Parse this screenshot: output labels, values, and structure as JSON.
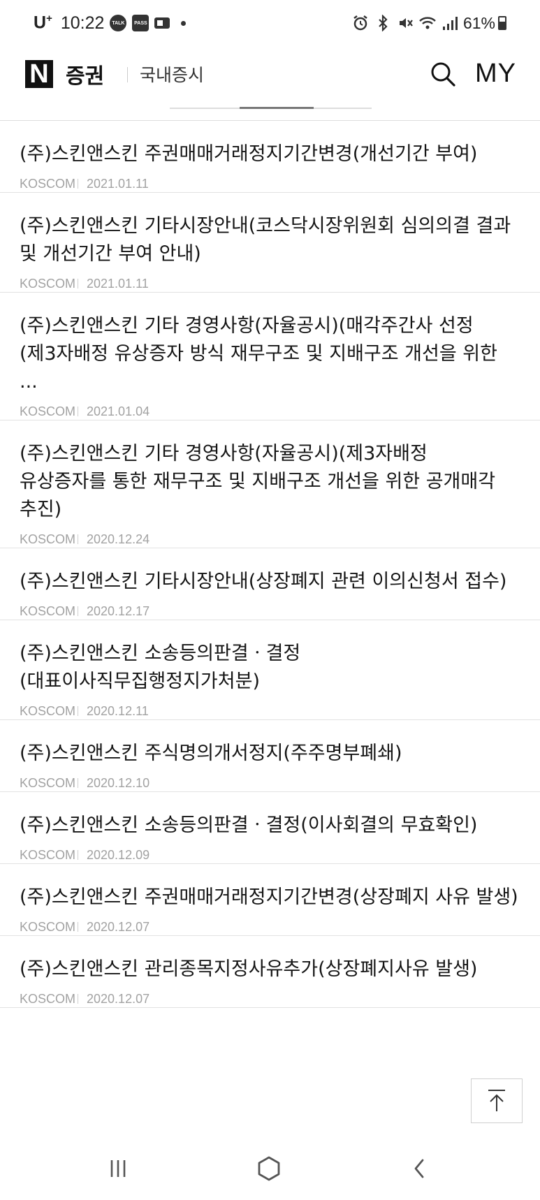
{
  "status_bar": {
    "carrier": "U",
    "carrier_sup": "+",
    "time": "10:22",
    "notif_apps": [
      "TALK",
      "PASS"
    ],
    "battery": "61%",
    "battery_level": 0.61
  },
  "header": {
    "logo_letter": "N",
    "logo_text": "증권",
    "section": "국내증시",
    "my_label": "MY"
  },
  "items": [
    {
      "title": "(주)스킨앤스킨 주권매매거래정지기간변경(개선기간 부여)",
      "source": "KOSCOM",
      "date": "2021.01.11"
    },
    {
      "title": "(주)스킨앤스킨 기타시장안내(코스닥시장위원회 심의의결 결과 및 개선기간 부여 안내)",
      "source": "KOSCOM",
      "date": "2021.01.11"
    },
    {
      "title": "(주)스킨앤스킨 기타 경영사항(자율공시)(매각주간사 선정(제3자배정 유상증자 방식 재무구조 및 지배구조 개선을 위한 ...",
      "source": "KOSCOM",
      "date": "2021.01.04"
    },
    {
      "title": "(주)스킨앤스킨 기타 경영사항(자율공시)(제3자배정 유상증자를 통한 재무구조 및 지배구조 개선을 위한 공개매각 추진)",
      "source": "KOSCOM",
      "date": "2020.12.24"
    },
    {
      "title": "(주)스킨앤스킨 기타시장안내(상장폐지 관련 이의신청서 접수)",
      "source": "KOSCOM",
      "date": "2020.12.17"
    },
    {
      "title": "(주)스킨앤스킨 소송등의판결ㆍ결정(대표이사직무집행정지가처분)",
      "source": "KOSCOM",
      "date": "2020.12.11"
    },
    {
      "title": "(주)스킨앤스킨 주식명의개서정지(주주명부폐쇄)",
      "source": "KOSCOM",
      "date": "2020.12.10"
    },
    {
      "title": "(주)스킨앤스킨 소송등의판결ㆍ결정(이사회결의 무효확인)",
      "source": "KOSCOM",
      "date": "2020.12.09"
    },
    {
      "title": "(주)스킨앤스킨 주권매매거래정지기간변경(상장폐지 사유 발생)",
      "source": "KOSCOM",
      "date": "2020.12.07"
    },
    {
      "title": "(주)스킨앤스킨 관리종목지정사유추가(상장폐지사유 발생)",
      "source": "KOSCOM",
      "date": "2020.12.07"
    }
  ],
  "icons": {
    "search": "search-icon",
    "to_top": "arrow-up-icon",
    "nav_recents": "recent-apps-icon",
    "nav_home": "home-icon",
    "nav_back": "back-icon"
  }
}
